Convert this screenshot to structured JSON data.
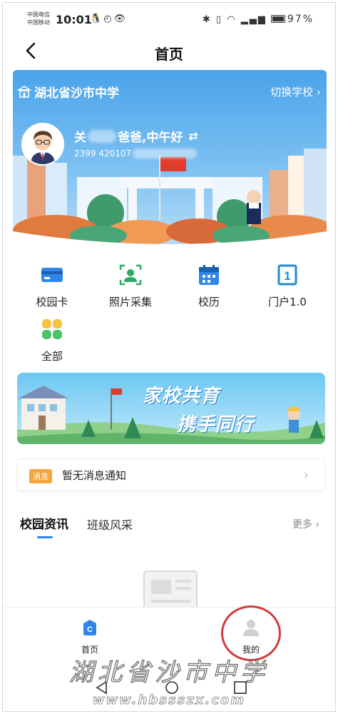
{
  "status_bar": {
    "carrier_1": "中国电信",
    "carrier_2": "中国移动",
    "time": "10:01",
    "battery": "97%"
  },
  "nav": {
    "title": "首页"
  },
  "banner": {
    "school_name": "湖北省沙市中学",
    "switch_label": "切换学校",
    "greeting_prefix": "关",
    "greeting_suffix": "爸爸,中午好",
    "account_prefix": "2399 420107"
  },
  "quick_menu": [
    {
      "label": "校园卡",
      "icon": "card-icon"
    },
    {
      "label": "照片采集",
      "icon": "photo-capture-icon"
    },
    {
      "label": "校历",
      "icon": "calendar-icon"
    },
    {
      "label": "门户1.0",
      "icon": "portal-icon"
    },
    {
      "label": "全部",
      "icon": "all-apps-icon"
    }
  ],
  "promo": {
    "line1": "家校共育",
    "line2": "携手同行"
  },
  "notice": {
    "badge": "消息",
    "text": "暂无消息通知"
  },
  "news": {
    "tabs": [
      "校园资讯",
      "班级风采"
    ],
    "more": "更多"
  },
  "tabbar": {
    "items": [
      {
        "label": "首页",
        "icon": "home-icon"
      },
      {
        "label": "我的",
        "icon": "profile-icon"
      }
    ]
  },
  "watermark": {
    "text": "湖北省沙市中学",
    "url": "www.hbssszx.com"
  },
  "colors": {
    "accent": "#2f86e6",
    "badge": "#f5a53a",
    "highlight_ring": "#d23b3b"
  }
}
